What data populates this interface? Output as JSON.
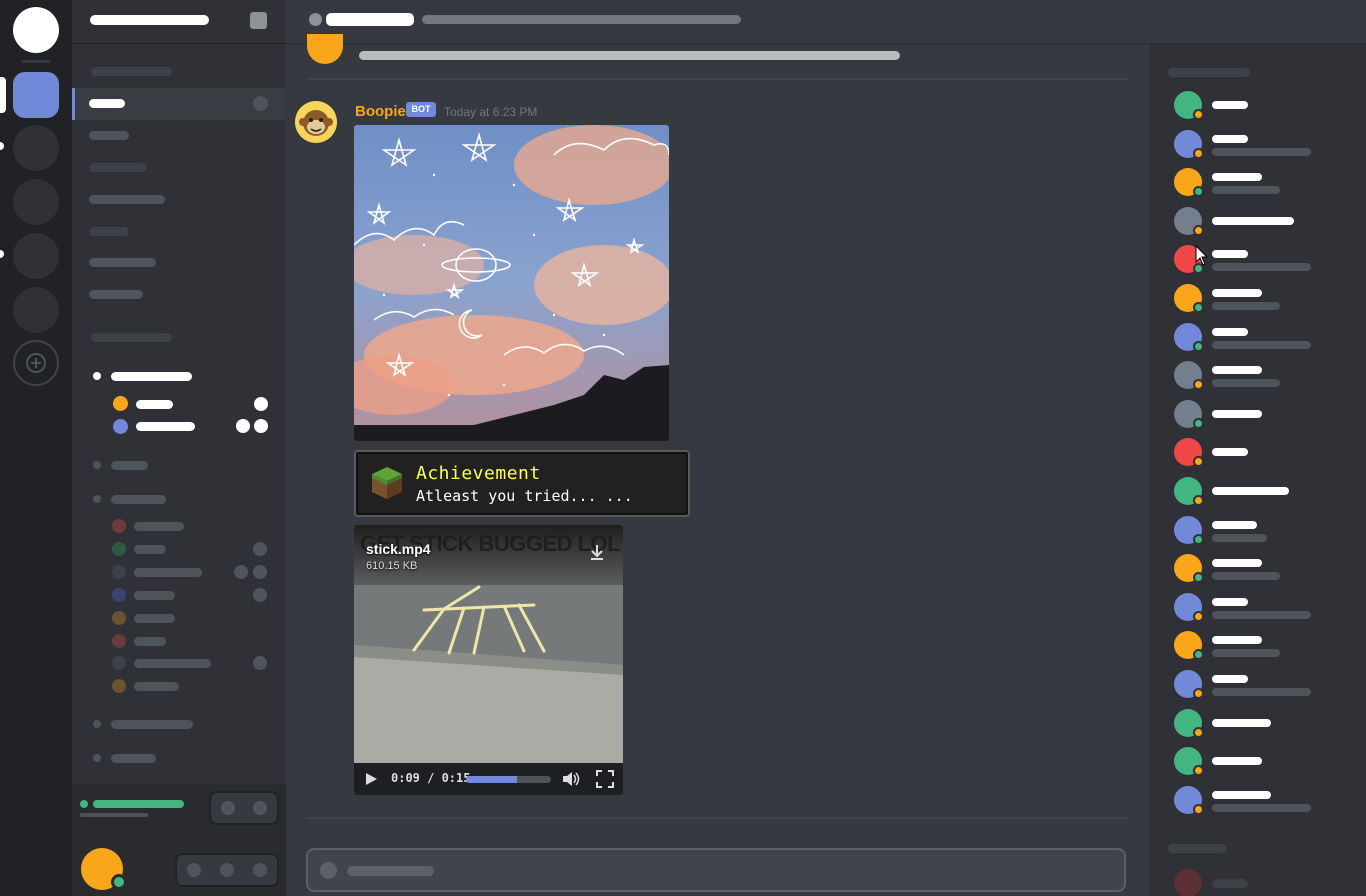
{
  "message": {
    "author": "Boopie",
    "bot_tag": "BOT",
    "timestamp": "Today at 6:23 PM",
    "achievement": {
      "title": "Achievement",
      "text": "Atleast you tried... ..."
    },
    "video": {
      "filename": "stick.mp4",
      "size": "610.15 KB",
      "caption_overlay": "GET STICK BUGGED LOL",
      "time": "0:09 / 0:15",
      "progress": 0.6
    }
  },
  "colors": {
    "accent": "#7289da",
    "online": "#43b581",
    "idle": "#faa61a",
    "dnd": "#f04747",
    "author": "#faa61a"
  },
  "icons": {
    "add_server": "plus-icon",
    "download": "download-icon",
    "play": "play-icon",
    "volume": "volume-icon",
    "fullscreen": "fullscreen-icon"
  }
}
